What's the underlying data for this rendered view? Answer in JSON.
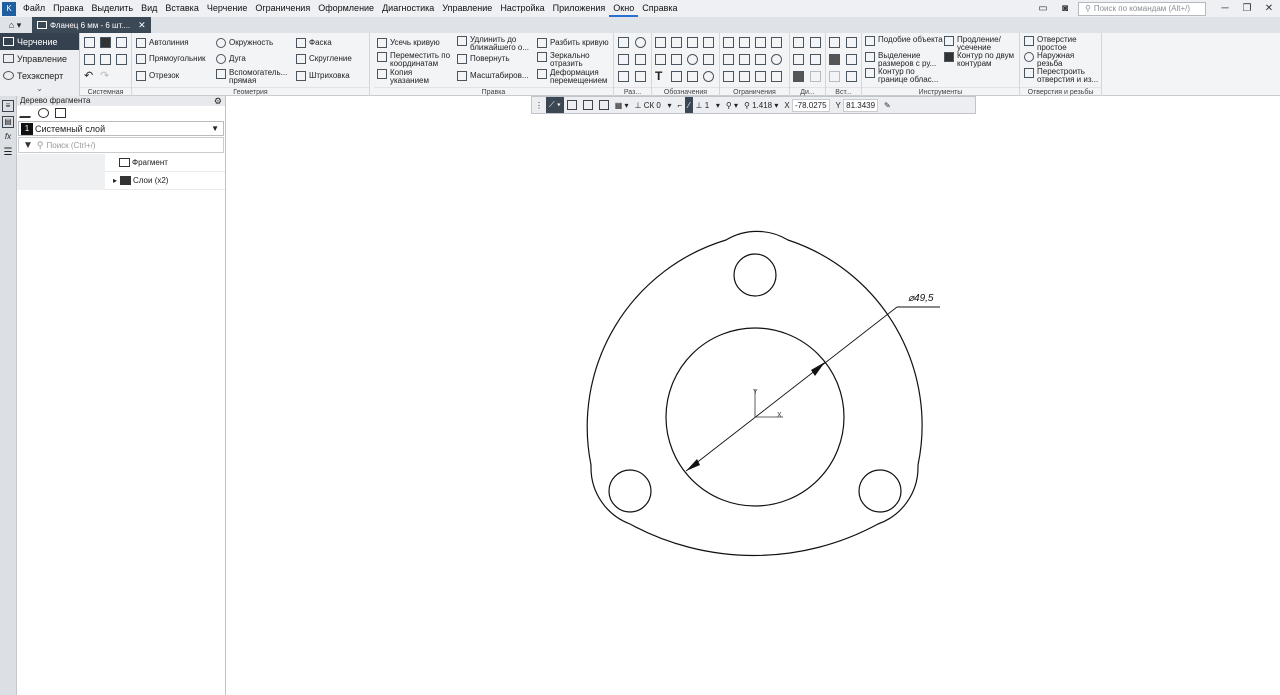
{
  "menubar": {
    "app_icon": "kompas-app-icon",
    "items": [
      "Файл",
      "Правка",
      "Выделить",
      "Вид",
      "Вставка",
      "Черчение",
      "Ограничения",
      "Оформление",
      "Диагностика",
      "Управление",
      "Настройка",
      "Приложения",
      "Окно",
      "Справка"
    ],
    "active_item": "Окно",
    "search_placeholder": "Поиск по командам (Alt+/)"
  },
  "tabbar": {
    "home_label": "⌂ ▾",
    "document_tab": "Фланец 6 мм - 6 шт....",
    "close": "✕"
  },
  "modes": [
    {
      "label": "Черчение",
      "active": true
    },
    {
      "label": "Управление",
      "active": false
    },
    {
      "label": "Техэксперт",
      "active": false
    }
  ],
  "modes_more": "⌄",
  "ribbon": {
    "groups": {
      "system": "Системная",
      "geometry": "Геометрия",
      "edit": "Правка",
      "size": "Раз...",
      "notation": "Обозначения",
      "constraints": "Ограничения",
      "di": "Ди...",
      "vst": "Вст...",
      "tools": "Инструменты",
      "holes": "Отверстия и резьбы"
    },
    "geometry_buttons": [
      "Автолиния",
      "Прямоугольник",
      "Отрезок",
      "Окружность",
      "Дуга",
      "Вспомогатель... прямая",
      "Фаска",
      "Скругление",
      "Штриховка"
    ],
    "edit_buttons": [
      "Усечь кривую",
      "Переместить по координатам",
      "Копия указанием",
      "Удлинить до ближайшего о...",
      "Повернуть",
      "Масштабиров...",
      "Разбить кривую",
      "Зеркально отразить",
      "Деформация перемещением"
    ],
    "tools_buttons": [
      "Подобие объекта",
      "Выделение размеров с ру...",
      "Контур по границе облас...",
      "Продление/ усечение",
      "Контур по двум контурам"
    ],
    "holes_buttons": [
      "Отверстие простое",
      "Наружная резьба",
      "Перестроить отверстия и из..."
    ]
  },
  "snapbar": {
    "cs": "СК 0",
    "layer": "1",
    "scale": "1.418",
    "x_label": "X",
    "x_value": "-78.0275",
    "y_label": "Y",
    "y_value": "81.3439"
  },
  "tree_panel": {
    "title": "Дерево фрагмента",
    "layer_number": "1",
    "layer_name": "Системный слой",
    "search_placeholder": "Поиск (Ctrl+/)",
    "rows": [
      {
        "label": "Фрагмент",
        "expander": ""
      },
      {
        "label": "Слои (x2)",
        "expander": "▸"
      }
    ]
  },
  "drawing": {
    "dimension_text": "⌀49,5",
    "axis_x_label": "X",
    "axis_y_label": "Y"
  }
}
